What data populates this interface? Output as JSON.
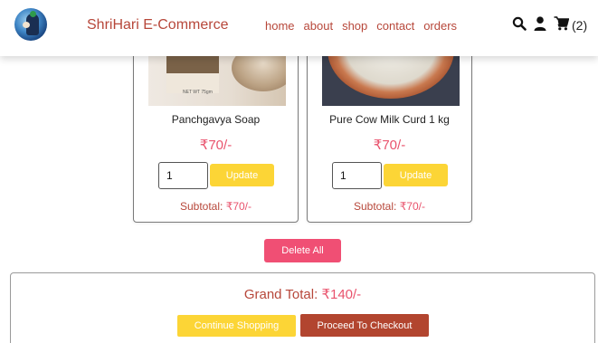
{
  "brand": {
    "name": "ShriHari E-Commerce"
  },
  "nav": [
    "home",
    "about",
    "shop",
    "contact",
    "orders"
  ],
  "header_icons": {
    "search": "search-icon",
    "user": "user-icon",
    "cart": "cart-icon",
    "cart_count": "(2)"
  },
  "products": [
    {
      "name": "Panchgavya Soap",
      "price": "₹70/-",
      "qty": "1",
      "update_label": "Update",
      "subtotal_label": "Subtotal:",
      "subtotal": "₹70/-",
      "image_label": "NET WT 75gm"
    },
    {
      "name": "Pure Cow Milk Curd 1 kg",
      "price": "₹70/-",
      "qty": "1",
      "update_label": "Update",
      "subtotal_label": "Subtotal:",
      "subtotal": "₹70/-"
    }
  ],
  "actions": {
    "delete_all": "Delete All"
  },
  "total": {
    "label": "Grand Total:",
    "value": "₹140/-"
  },
  "footer_buttons": {
    "continue": "Continue Shopping",
    "checkout": "Proceed To Checkout"
  },
  "colors": {
    "brand": "#b7473a",
    "price": "#e9536d",
    "yellow": "#fcd536",
    "delete": "#f04f74",
    "checkout": "#b2452f"
  }
}
